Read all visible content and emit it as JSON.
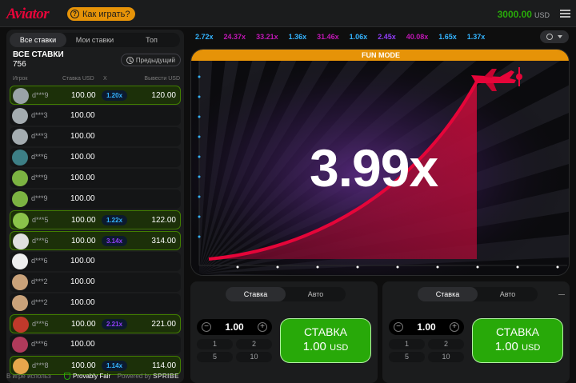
{
  "header": {
    "logo": "Aviator",
    "how_to_play": "Как играть?",
    "balance": "3000.00",
    "currency": "USD"
  },
  "sidebar": {
    "tabs": [
      "Все ставки",
      "Мои ставки",
      "Топ"
    ],
    "title": "ВСЕ СТАВКИ",
    "count": "756",
    "previous": "Предыдущий",
    "columns": {
      "player": "Игрок",
      "bet": "Ставка USD",
      "mult": "X",
      "cashout": "Вывести USD"
    },
    "rows": [
      {
        "name": "d***9",
        "bet": "100.00",
        "mult": "1.20x",
        "win": "120.00",
        "won": true,
        "mcolor": "#34b4ff",
        "avatar": "#9aa3a8"
      },
      {
        "name": "d***3",
        "bet": "100.00",
        "mult": "",
        "win": "",
        "won": false,
        "mcolor": "",
        "avatar": "#a4acb0"
      },
      {
        "name": "d***3",
        "bet": "100.00",
        "mult": "",
        "win": "",
        "won": false,
        "mcolor": "",
        "avatar": "#a4acb0"
      },
      {
        "name": "d***6",
        "bet": "100.00",
        "mult": "",
        "win": "",
        "won": false,
        "mcolor": "",
        "avatar": "#3d7f86"
      },
      {
        "name": "d***9",
        "bet": "100.00",
        "mult": "",
        "win": "",
        "won": false,
        "mcolor": "",
        "avatar": "#7cb342"
      },
      {
        "name": "d***9",
        "bet": "100.00",
        "mult": "",
        "win": "",
        "won": false,
        "mcolor": "",
        "avatar": "#7cb342"
      },
      {
        "name": "d***5",
        "bet": "100.00",
        "mult": "1.22x",
        "win": "122.00",
        "won": true,
        "mcolor": "#34b4ff",
        "avatar": "#8bc34a"
      },
      {
        "name": "d***6",
        "bet": "100.00",
        "mult": "3.14x",
        "win": "314.00",
        "won": true,
        "mcolor": "#913ef8",
        "avatar": "#e0e0e0"
      },
      {
        "name": "d***6",
        "bet": "100.00",
        "mult": "",
        "win": "",
        "won": false,
        "mcolor": "",
        "avatar": "#eeeeee"
      },
      {
        "name": "d***2",
        "bet": "100.00",
        "mult": "",
        "win": "",
        "won": false,
        "mcolor": "",
        "avatar": "#c9a27a"
      },
      {
        "name": "d***2",
        "bet": "100.00",
        "mult": "",
        "win": "",
        "won": false,
        "mcolor": "",
        "avatar": "#c9a27a"
      },
      {
        "name": "d***6",
        "bet": "100.00",
        "mult": "2.21x",
        "win": "221.00",
        "won": true,
        "mcolor": "#913ef8",
        "avatar": "#c0392b"
      },
      {
        "name": "d***6",
        "bet": "100.00",
        "mult": "",
        "win": "",
        "won": false,
        "mcolor": "",
        "avatar": "#b03a5b"
      },
      {
        "name": "d***8",
        "bet": "100.00",
        "mult": "1.14x",
        "win": "114.00",
        "won": true,
        "mcolor": "#34b4ff",
        "avatar": "#e6a64c"
      }
    ],
    "footer": {
      "in_game": "В игре использ",
      "provably_fair": "Provably Fair",
      "powered": "Powered by",
      "brand": "SPRIBE"
    }
  },
  "history": [
    {
      "v": "2.72x",
      "c": "#34b4ff"
    },
    {
      "v": "24.37x",
      "c": "#c017b4"
    },
    {
      "v": "33.21x",
      "c": "#c017b4"
    },
    {
      "v": "1.36x",
      "c": "#34b4ff"
    },
    {
      "v": "31.46x",
      "c": "#c017b4"
    },
    {
      "v": "1.06x",
      "c": "#34b4ff"
    },
    {
      "v": "2.45x",
      "c": "#913ef8"
    },
    {
      "v": "40.08x",
      "c": "#c017b4"
    },
    {
      "v": "1.65x",
      "c": "#34b4ff"
    },
    {
      "v": "1.37x",
      "c": "#34b4ff"
    }
  ],
  "game": {
    "mode": "FUN MODE",
    "multiplier": "3.99x"
  },
  "bet_panels": [
    {
      "tab_bet": "Ставка",
      "tab_auto": "Авто",
      "amount": "1.00",
      "quick": [
        "1",
        "2",
        "5",
        "10"
      ],
      "button_title": "СТАВКА",
      "button_amount": "1.00",
      "button_currency": "USD"
    },
    {
      "tab_bet": "Ставка",
      "tab_auto": "Авто",
      "amount": "1.00",
      "quick": [
        "1",
        "2",
        "5",
        "10"
      ],
      "button_title": "СТАВКА",
      "button_amount": "1.00",
      "button_currency": "USD"
    }
  ],
  "colors": {
    "accent": "#e50539",
    "win_green": "#28a909",
    "fun_mode": "#e69308"
  }
}
